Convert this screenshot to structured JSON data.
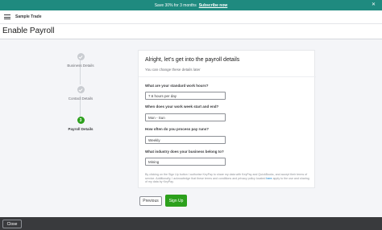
{
  "promo": {
    "text": "Save 30% for 3 months",
    "link": "Subscribe now",
    "close_icon": "close-icon"
  },
  "topbar": {
    "menu_icon": "hamburger-icon",
    "company": "Sample Trade"
  },
  "page": {
    "title": "Enable Payroll"
  },
  "steps": [
    {
      "label": "Business Details",
      "state": "done",
      "icon": "check-icon"
    },
    {
      "label": "Contact Details",
      "state": "done",
      "icon": "check-icon"
    },
    {
      "label": "Payroll Details",
      "state": "active",
      "number": "3"
    }
  ],
  "form": {
    "heading": "Alright, let's get into the payroll details",
    "subheading": "You can change these details later",
    "questions": [
      {
        "label": "What are your standard work hours?",
        "value": "7.6 hours per day"
      },
      {
        "label": "When does your work week start and end?",
        "value": "Mon - Sun"
      },
      {
        "label": "How often do you process pay runs?",
        "value": "Weekly"
      },
      {
        "label": "What industry does your business belong to?",
        "value": "Mining"
      }
    ],
    "terms_text": "By clicking on the Sign Up button I authorise KeyPay to share my data with KeyPay and QuickBooks, and accept their terms of service. Additionally, I acknowledge that these terms and conditions and privacy policy located",
    "terms_link": "here",
    "terms_tail": "apply to the use and sharing of my data by KeyPay."
  },
  "actions": {
    "previous": "Previous",
    "signup": "Sign Up"
  },
  "footer": {
    "close": "Close"
  },
  "colors": {
    "brand_green": "#2ca01c",
    "promo_teal": "#1f8a7f",
    "footer_dark": "#393a3d"
  }
}
